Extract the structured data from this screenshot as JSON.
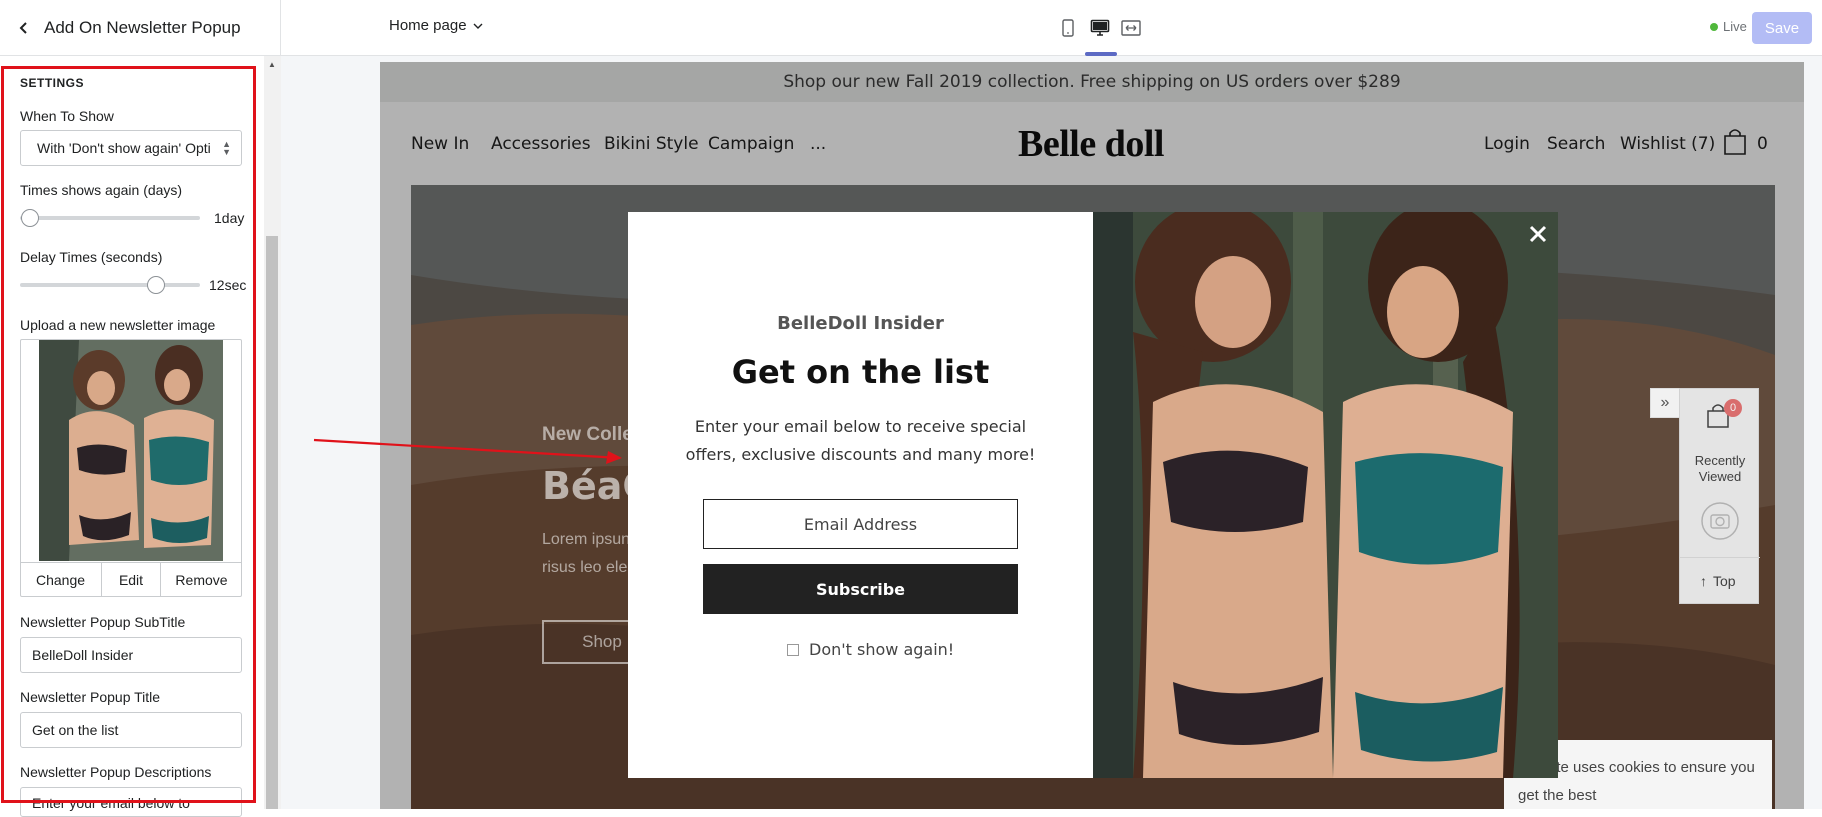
{
  "editor": {
    "sidebar_title": "Add On Newsletter Popup",
    "page_select": "Home page",
    "live_label": "Live",
    "save_label": "Save"
  },
  "sidebar": {
    "heading": "SETTINGS",
    "when_to_show": {
      "label": "When To Show",
      "value": "With 'Don't show again' Opti"
    },
    "times_show_again": {
      "label": "Times shows again (days)",
      "value_text": "1day",
      "value": 1
    },
    "delay_times": {
      "label": "Delay Times (seconds)",
      "value_text": "12sec",
      "value": 12
    },
    "upload_label": "Upload a new newsletter image",
    "image_actions": {
      "change": "Change",
      "edit": "Edit",
      "remove": "Remove"
    },
    "subtitle": {
      "label": "Newsletter Popup SubTitle",
      "value": "BelleDoll Insider"
    },
    "title": {
      "label": "Newsletter Popup Title",
      "value": "Get on the list"
    },
    "descriptions": {
      "label": "Newsletter Popup Descriptions",
      "value": "Enter your email below to"
    }
  },
  "store": {
    "announcement": "Shop our new Fall 2019 collection. Free shipping on US orders over $289",
    "nav_left": [
      "New In",
      "Accessories",
      "Bikini Style",
      "Campaign",
      "..."
    ],
    "logo": "Belle doll",
    "nav_right": {
      "login": "Login",
      "search": "Search",
      "wishlist": "Wishlist (7)",
      "cart_count": "0"
    },
    "hero": {
      "small": "New Colle",
      "big": "BéaC",
      "lorem_1": "Lorem ipsun",
      "lorem_2": "risus leo ele",
      "shop": "Shop"
    },
    "recently_viewed": {
      "badge": "0",
      "label": "Recently Viewed",
      "top": "Top"
    },
    "cookie_text": "website uses cookies to ensure you get the best"
  },
  "popup": {
    "subtitle": "BelleDoll Insider",
    "title": "Get on the list",
    "desc_line1": "Enter your email below to receive special",
    "desc_line2": "offers, exclusive discounts and many more!",
    "email_placeholder": "Email Address",
    "subscribe": "Subscribe",
    "dont_show": "Don't show again!"
  },
  "colors": {
    "accent": "#5c6ac4",
    "save_disabled": "#b3bcf5",
    "annotation_red": "#e0121a",
    "live_green": "#50b83c"
  }
}
